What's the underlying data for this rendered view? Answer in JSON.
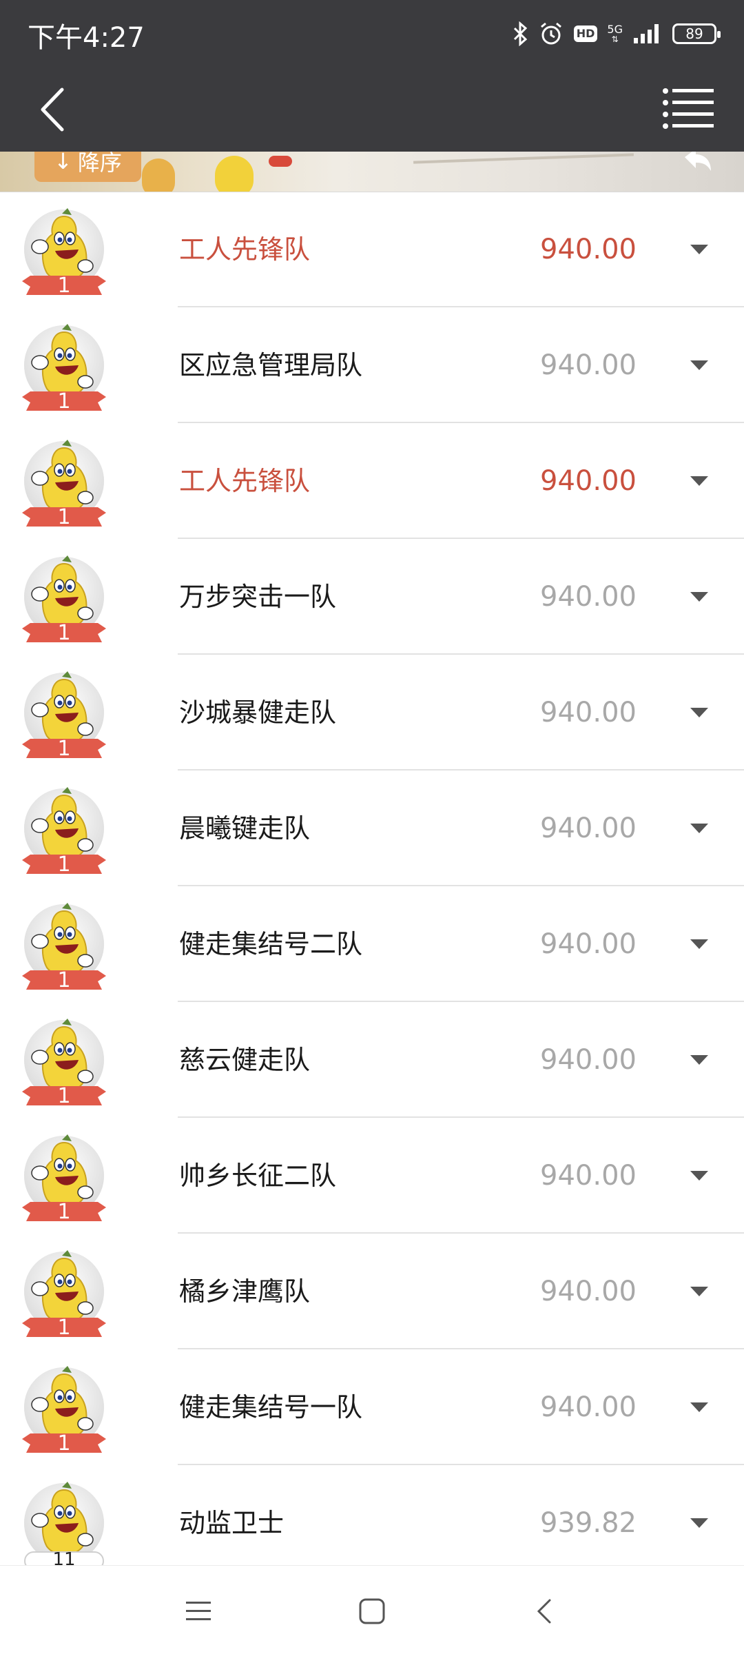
{
  "status_bar": {
    "time": "下午4:27",
    "network": "5G",
    "hd": "HD",
    "battery": "89"
  },
  "sort_button": {
    "label": "降序",
    "arrow": "↓"
  },
  "colors": {
    "highlight": "#c9503e",
    "nav_bg": "#3b3b3e",
    "score_gray": "#a8a8a8",
    "ribbon_red": "#e15a4a"
  },
  "rows": [
    {
      "name": "工人先锋队",
      "score": "940.00",
      "rank": "1",
      "highlight": true
    },
    {
      "name": "区应急管理局队",
      "score": "940.00",
      "rank": "1",
      "highlight": false
    },
    {
      "name": "工人先锋队",
      "score": "940.00",
      "rank": "1",
      "highlight": true
    },
    {
      "name": "万步突击一队",
      "score": "940.00",
      "rank": "1",
      "highlight": false
    },
    {
      "name": "沙城暴健走队",
      "score": "940.00",
      "rank": "1",
      "highlight": false
    },
    {
      "name": "晨曦键走队",
      "score": "940.00",
      "rank": "1",
      "highlight": false
    },
    {
      "name": "健走集结号二队",
      "score": "940.00",
      "rank": "1",
      "highlight": false
    },
    {
      "name": "慈云健走队",
      "score": "940.00",
      "rank": "1",
      "highlight": false
    },
    {
      "name": "帅乡长征二队",
      "score": "940.00",
      "rank": "1",
      "highlight": false
    },
    {
      "name": "橘乡津鹰队",
      "score": "940.00",
      "rank": "1",
      "highlight": false
    },
    {
      "name": "健走集结号一队",
      "score": "940.00",
      "rank": "1",
      "highlight": false
    },
    {
      "name": "动监卫士",
      "score": "939.82",
      "rank": "11",
      "highlight": false,
      "plain_badge": true
    }
  ]
}
